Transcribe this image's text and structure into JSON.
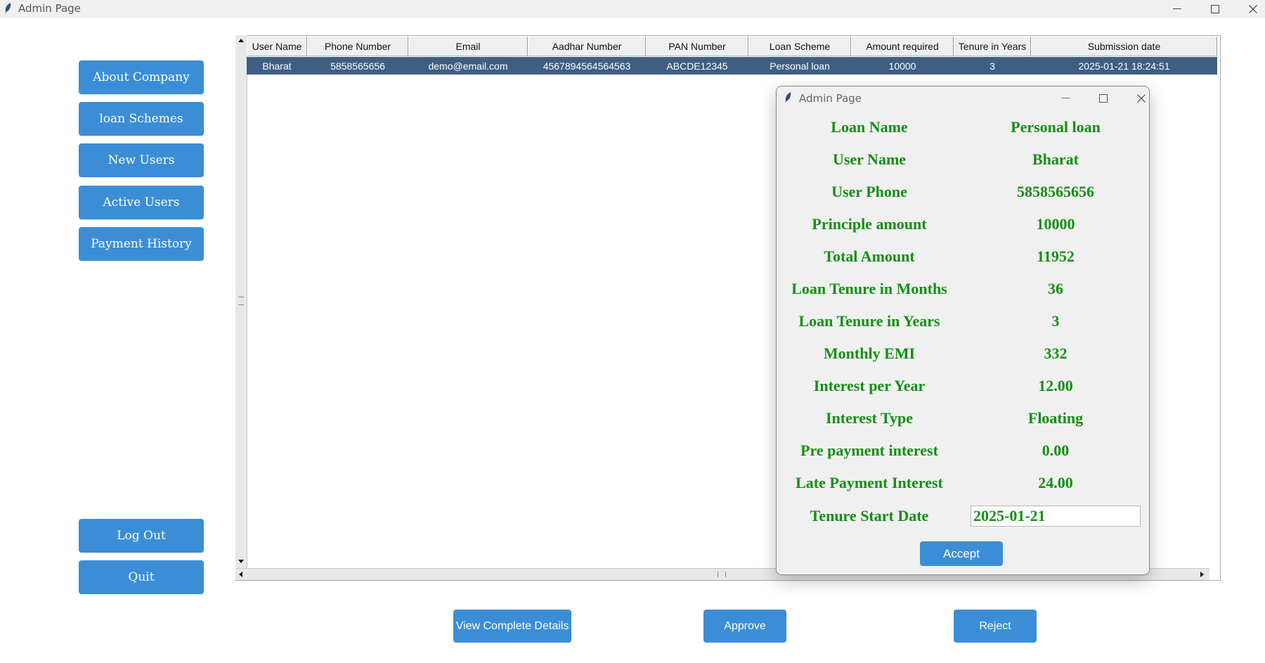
{
  "window": {
    "title": "Admin Page",
    "icon": "feather-icon"
  },
  "sidebar": {
    "items": [
      {
        "label": "About Company"
      },
      {
        "label": "loan Schemes"
      },
      {
        "label": "New Users"
      },
      {
        "label": "Active Users"
      },
      {
        "label": "Payment History"
      }
    ],
    "logout_label": "Log Out",
    "quit_label": "Quit"
  },
  "table": {
    "columns": [
      "User Name",
      "Phone Number",
      "Email",
      "Aadhar Number",
      "PAN Number",
      "Loan Scheme",
      "Amount required",
      "Tenure in Years",
      "Submission date"
    ],
    "rows": [
      [
        "Bharat",
        "5858565656",
        "demo@email.com",
        "4567894564564563",
        "ABCDE12345",
        "Personal loan",
        "10000",
        "3",
        "2025-01-21 18:24:51"
      ]
    ],
    "selected_row": 0
  },
  "actions": {
    "view_label": "View Complete Details",
    "approve_label": "Approve",
    "reject_label": "Reject"
  },
  "dialog": {
    "title": "Admin Page",
    "fields": [
      {
        "label": "Loan Name",
        "value": "Personal loan"
      },
      {
        "label": "User Name",
        "value": "Bharat"
      },
      {
        "label": "User Phone",
        "value": "5858565656"
      },
      {
        "label": "Principle amount",
        "value": "10000"
      },
      {
        "label": "Total Amount",
        "value": "11952"
      },
      {
        "label": "Loan Tenure in Months",
        "value": "36"
      },
      {
        "label": "Loan Tenure in Years",
        "value": "3"
      },
      {
        "label": "Monthly EMI",
        "value": "332"
      },
      {
        "label": "Interest per Year",
        "value": "12.00"
      },
      {
        "label": "Interest Type",
        "value": "Floating"
      },
      {
        "label": "Pre payment interest",
        "value": "0.00"
      },
      {
        "label": "Late Payment Interest",
        "value": "24.00"
      }
    ],
    "start_date_label": "Tenure Start Date",
    "start_date_value": "2025-01-21",
    "accept_label": "Accept"
  },
  "colors": {
    "button": "#3b8ed6",
    "selected_row": "#3f5f82",
    "dialog_text": "#148f14"
  }
}
